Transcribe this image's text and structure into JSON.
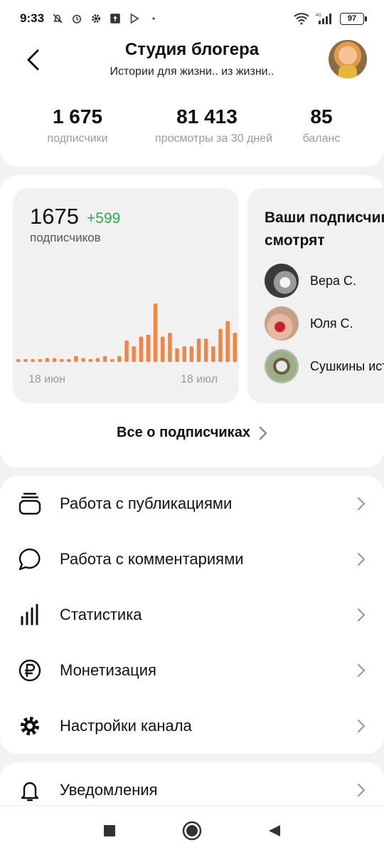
{
  "status_bar": {
    "time": "9:33",
    "battery": "97",
    "network": "4G"
  },
  "header": {
    "title": "Студия блогера",
    "subtitle": "Истории для жизни.. из жизни..",
    "back_icon": "chevron-left-icon",
    "avatar_icon": "profile-avatar"
  },
  "stats": [
    {
      "value": "1 675",
      "label": "подписчики"
    },
    {
      "value": "81 413",
      "label": "просмотры за 30 дней"
    },
    {
      "value": "85",
      "label": "баланс"
    }
  ],
  "subscribers": {
    "count": "1675",
    "delta": "+599",
    "label": "подписчиков",
    "axis_start": "18 июн",
    "axis_end": "18 июл",
    "bar_color": "#f0854a",
    "delta_color": "#2fa84f",
    "chart_data": {
      "type": "bar",
      "values": [
        1,
        1,
        1,
        1,
        2,
        2,
        1,
        1,
        3,
        2,
        1,
        2,
        3,
        1,
        3,
        11,
        8,
        13,
        14,
        30,
        13,
        15,
        7,
        8,
        8,
        12,
        12,
        8,
        17,
        21,
        15,
        1
      ]
    }
  },
  "watching": {
    "title_line1": "Ваши подписчики",
    "title_line2": "смотрят",
    "items": [
      {
        "name": "Вера С."
      },
      {
        "name": "Юля С."
      },
      {
        "name": "Сушкины истории"
      }
    ]
  },
  "all_subscribers_link": "Все о подписчиках",
  "menu": [
    {
      "label": "Работа с публикациями",
      "icon": "publications-stack-icon"
    },
    {
      "label": "Работа с комментариями",
      "icon": "comment-bubble-icon"
    },
    {
      "label": "Статистика",
      "icon": "bar-chart-icon"
    },
    {
      "label": "Монетизация",
      "icon": "ruble-coin-icon"
    },
    {
      "label": "Настройки канала",
      "icon": "gear-icon"
    },
    {
      "label": "Уведомления",
      "icon": "bell-icon"
    }
  ],
  "navbar": {
    "icons": [
      "recents-square-icon",
      "home-circle-icon",
      "back-triangle-icon"
    ]
  }
}
